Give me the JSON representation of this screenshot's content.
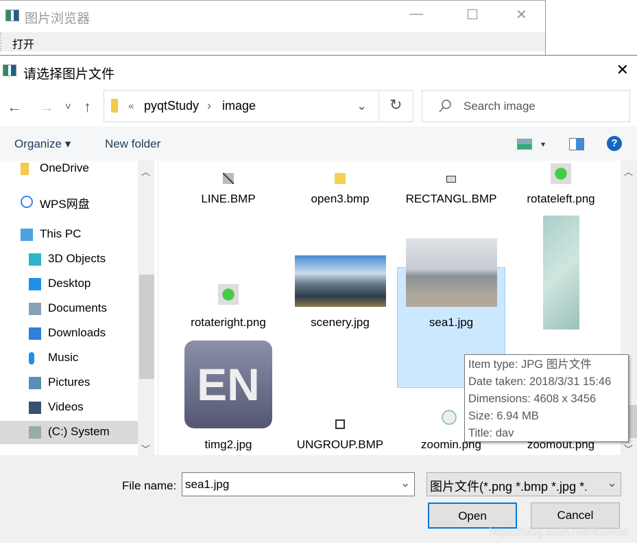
{
  "bg_window": {
    "title": "图片浏览器",
    "menu_open": "打开",
    "minimize": "—",
    "maximize": "☐",
    "close": "✕"
  },
  "dialog": {
    "title": "请选择图片文件",
    "close": "✕"
  },
  "nav": {
    "back": "←",
    "forward": "→",
    "recent": "˅",
    "up": "↑",
    "breadcrumb_prefix": "«",
    "path": [
      "pyqtStudy",
      "image"
    ],
    "path_sep": "›",
    "dropdown": "⌄",
    "refresh": "↻",
    "search_placeholder": "Search image"
  },
  "toolbar": {
    "organize": "Organize ▾",
    "new_folder": "New folder",
    "view": "▾",
    "help": "?"
  },
  "sidebar": {
    "items": [
      {
        "label": "OneDrive",
        "icon": "folder-icon",
        "color": "#f5c94a",
        "indent": 0
      },
      {
        "label": "WPS网盘",
        "icon": "cloud-icon",
        "color": "#3b82f6",
        "indent": 0
      },
      {
        "label": "This PC",
        "icon": "computer-icon",
        "color": "#4aa3df",
        "indent": 0
      },
      {
        "label": "3D Objects",
        "icon": "cube-icon",
        "color": "#2bb6c8",
        "indent": 1
      },
      {
        "label": "Desktop",
        "icon": "desktop-icon",
        "color": "#1e90e8",
        "indent": 1
      },
      {
        "label": "Documents",
        "icon": "document-icon",
        "color": "#8aa0b8",
        "indent": 1
      },
      {
        "label": "Downloads",
        "icon": "download-icon",
        "color": "#2f7fd8",
        "indent": 1
      },
      {
        "label": "Music",
        "icon": "music-icon",
        "color": "#1e90e8",
        "indent": 1
      },
      {
        "label": "Pictures",
        "icon": "pictures-icon",
        "color": "#5b8fb0",
        "indent": 1
      },
      {
        "label": "Videos",
        "icon": "videos-icon",
        "color": "#3a5070",
        "indent": 1
      },
      {
        "label": "(C:) System",
        "icon": "drive-icon",
        "color": "#9aa",
        "indent": 1,
        "selected": true
      }
    ]
  },
  "files": [
    {
      "name": "LINE.BMP",
      "icon": "line-icon"
    },
    {
      "name": "open3.bmp",
      "icon": "open-folder-icon"
    },
    {
      "name": "RECTANGL.BMP",
      "icon": "rectangle-icon"
    },
    {
      "name": "rotateleft.png",
      "icon": "rotate-left-icon"
    },
    {
      "name": "rotateright.png",
      "icon": "rotate-right-icon"
    },
    {
      "name": "scenery.jpg",
      "icon": "mountain-thumbnail"
    },
    {
      "name": "sea1.jpg",
      "icon": "sea-thumbnail",
      "selected": true
    },
    {
      "name": "",
      "icon": "marble-thumbnail"
    },
    {
      "name": "timg2.jpg",
      "icon": "en-thumbnail",
      "thumb_text": "EN"
    },
    {
      "name": "UNGROUP.BMP",
      "icon": "ungroup-icon"
    },
    {
      "name": "zoomin.png",
      "icon": "zoom-in-icon"
    },
    {
      "name": "zoomout.png",
      "icon": "zoom-out-icon"
    }
  ],
  "tooltip": {
    "lines": [
      "Item type: JPG 图片文件",
      "Date taken: 2018/3/31 15:46",
      "Dimensions: 4608 x 3456",
      "Size: 6.94 MB",
      "Title: dav"
    ]
  },
  "bottom": {
    "file_name_label": "File name:",
    "file_name_value": "sea1.jpg",
    "file_type": "图片文件(*.png *.bmp *.jpg *.jpeg)",
    "open": "Open",
    "cancel": "Cancel"
  },
  "watermark": "https://blog.csdn.net/fatomsc"
}
